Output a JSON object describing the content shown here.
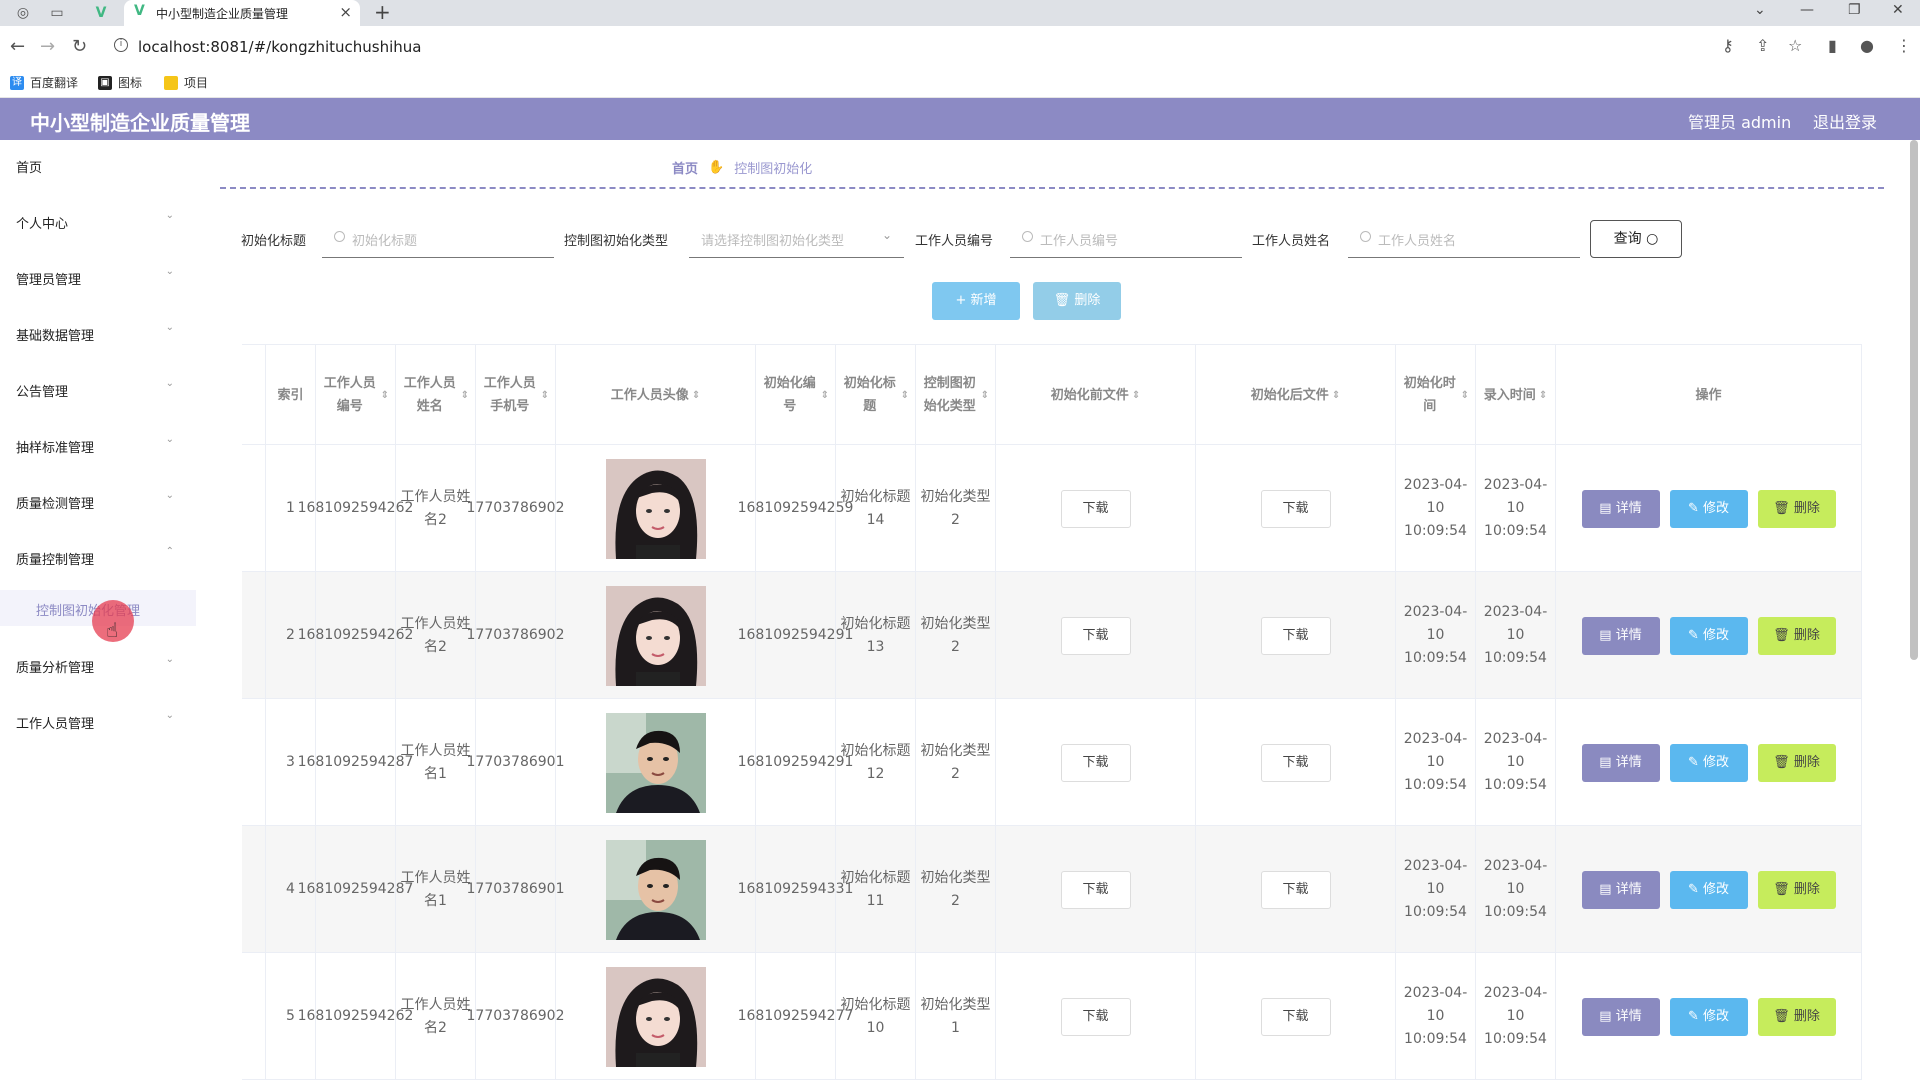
{
  "browser": {
    "tab_title": "中小型制造企业质量管理",
    "url": "localhost:8081/#/kongzhituchushihua",
    "bookmarks": [
      "百度翻译",
      "图标",
      "项目"
    ]
  },
  "header": {
    "title": "中小型制造企业质量管理",
    "user": "管理员 admin",
    "logout": "退出登录"
  },
  "sidebar": {
    "items": [
      {
        "label": "首页"
      },
      {
        "label": "个人中心"
      },
      {
        "label": "管理员管理"
      },
      {
        "label": "基础数据管理"
      },
      {
        "label": "公告管理"
      },
      {
        "label": "抽样标准管理"
      },
      {
        "label": "质量检测管理"
      },
      {
        "label": "质量控制管理"
      },
      {
        "label": "质量分析管理"
      },
      {
        "label": "工作人员管理"
      }
    ],
    "active_sub": "控制图初始化管理"
  },
  "breadcrumb": {
    "home": "首页",
    "current": "控制图初始化"
  },
  "search": {
    "title_label": "初始化标题",
    "title_placeholder": "初始化标题",
    "type_label": "控制图初始化类型",
    "type_placeholder": "请选择控制图初始化类型",
    "staff_no_label": "工作人员编号",
    "staff_no_placeholder": "工作人员编号",
    "staff_name_label": "工作人员姓名",
    "staff_name_placeholder": "工作人员姓名",
    "query_label": "查询"
  },
  "actions": {
    "add": "+ 新增",
    "delete": "删除"
  },
  "table": {
    "headers": [
      "索引",
      "工作人员编号",
      "工作人员姓名",
      "工作人员手机号",
      "工作人员头像",
      "初始化编号",
      "初始化标题",
      "控制图初始化类型",
      "初始化前文件",
      "初始化后文件",
      "初始化时间",
      "录入时间",
      "操作"
    ],
    "download_label": "下载",
    "op_detail": "详情",
    "op_edit": "修改",
    "op_delete": "删除",
    "rows": [
      {
        "index": "1",
        "staff_no": "1681092594262",
        "staff_name": "工作人员姓名2",
        "phone": "17703786902",
        "avatar": "female",
        "init_no": "1681092594259",
        "init_title": "初始化标题14",
        "init_type": "初始化类型2",
        "init_time": "2023-04-10 10:09:54",
        "entry_time": "2023-04-10 10:09:54"
      },
      {
        "index": "2",
        "staff_no": "1681092594262",
        "staff_name": "工作人员姓名2",
        "phone": "17703786902",
        "avatar": "female",
        "init_no": "1681092594291",
        "init_title": "初始化标题13",
        "init_type": "初始化类型2",
        "init_time": "2023-04-10 10:09:54",
        "entry_time": "2023-04-10 10:09:54"
      },
      {
        "index": "3",
        "staff_no": "1681092594287",
        "staff_name": "工作人员姓名1",
        "phone": "17703786901",
        "avatar": "male",
        "init_no": "1681092594291",
        "init_title": "初始化标题12",
        "init_type": "初始化类型2",
        "init_time": "2023-04-10 10:09:54",
        "entry_time": "2023-04-10 10:09:54"
      },
      {
        "index": "4",
        "staff_no": "1681092594287",
        "staff_name": "工作人员姓名1",
        "phone": "17703786901",
        "avatar": "male",
        "init_no": "1681092594331",
        "init_title": "初始化标题11",
        "init_type": "初始化类型2",
        "init_time": "2023-04-10 10:09:54",
        "entry_time": "2023-04-10 10:09:54"
      },
      {
        "index": "5",
        "staff_no": "1681092594262",
        "staff_name": "工作人员姓名2",
        "phone": "17703786902",
        "avatar": "female",
        "init_no": "1681092594277",
        "init_title": "初始化标题10",
        "init_type": "初始化类型1",
        "init_time": "2023-04-10 10:09:54",
        "entry_time": "2023-04-10 10:09:54"
      }
    ]
  },
  "colors": {
    "primary": "#8c8ac4",
    "edit": "#5bb8ef",
    "delete": "#c6ec5c"
  }
}
